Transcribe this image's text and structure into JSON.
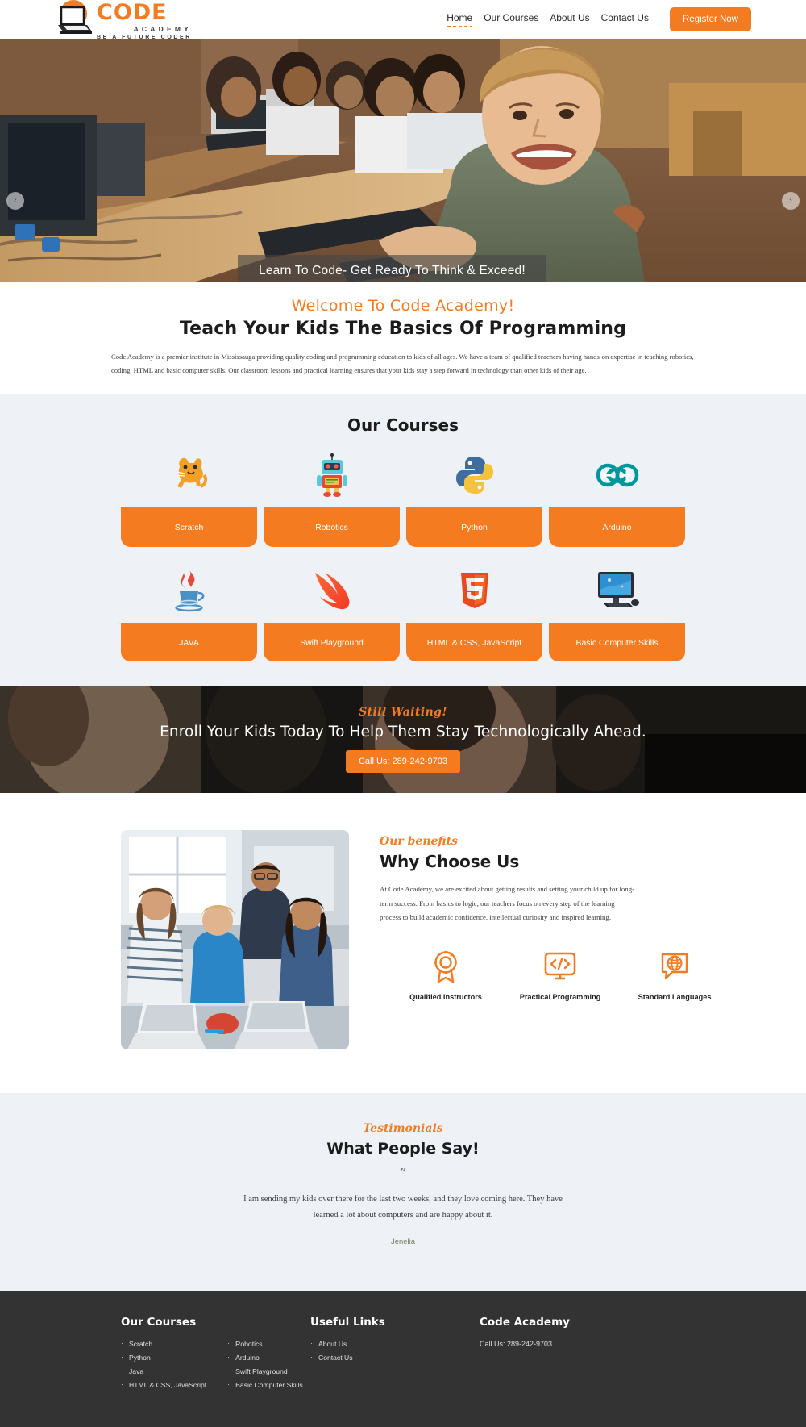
{
  "header": {
    "logo": {
      "code": "CODE",
      "academy": "ACADEMY",
      "tagline": "BE A FUTURE CODER"
    },
    "nav": [
      {
        "label": "Home",
        "active": true
      },
      {
        "label": "Our Courses",
        "active": false
      },
      {
        "label": "About Us",
        "active": false
      },
      {
        "label": "Contact Us",
        "active": false
      }
    ],
    "register_label": "Register Now"
  },
  "hero": {
    "caption": "Learn To Code- Get Ready To Think & Exceed!",
    "prev_icon": "chevron-left-icon",
    "next_icon": "chevron-right-icon"
  },
  "welcome": {
    "kicker": "Welcome To Code Academy!",
    "title": "Teach Your Kids The Basics Of Programming",
    "body": "Code Academy is a premier institute in Mississauga providing quality coding and programming education to kids of all ages. We have a team of qualified teachers having hands-on expertise in teaching robotics, coding, HTML and basic computer skills. Our classroom lessons and practical learning ensures that your kids stay a step forward in technology than other kids of their age."
  },
  "courses": {
    "title": "Our Courses",
    "row1": [
      {
        "label": "Scratch",
        "icon": "scratch-cat-icon"
      },
      {
        "label": "Robotics",
        "icon": "robot-icon"
      },
      {
        "label": "Python",
        "icon": "python-logo-icon"
      },
      {
        "label": "Arduino",
        "icon": "arduino-infinity-icon"
      }
    ],
    "row2": [
      {
        "label": "JAVA",
        "icon": "java-coffee-cup-icon"
      },
      {
        "label": "Swift Playground",
        "icon": "swift-bird-icon"
      },
      {
        "label": "HTML & CSS, JavaScript",
        "icon": "html5-shield-icon"
      },
      {
        "label": "Basic Computer Skills",
        "icon": "desktop-computer-icon"
      }
    ]
  },
  "cta": {
    "kicker": "Still Waiting!",
    "headline": "Enroll Your Kids Today To Help Them Stay Technologically Ahead.",
    "button": "Call Us: 289-242-9703"
  },
  "why": {
    "kicker": "Our benefits",
    "title": "Why Choose Us",
    "body": "At Code Academy, we are excited about getting results and setting your child up for long-term success. From basics to logic, our teachers focus on every step of the learning process to build academic confidence, intellectual curiosity and inspired learning.",
    "benefits": [
      {
        "label": "Qualified Instructors",
        "icon": "award-badge-icon"
      },
      {
        "label": "Practical Programming",
        "icon": "code-monitor-icon"
      },
      {
        "label": "Standard Languages",
        "icon": "globe-speech-icon"
      }
    ]
  },
  "testimonials": {
    "kicker": "Testimonials",
    "title": "What People Say!",
    "quote_mark": "”",
    "text": "I am sending my kids over there for the last two weeks, and they love coming here. They have learned a lot about computers and are happy about it.",
    "author": "Jenelia"
  },
  "footer": {
    "courses_heading": "Our Courses",
    "courses_col1": [
      "Scratch",
      "Python",
      "Java",
      "HTML & CSS, JavaScript"
    ],
    "courses_col2": [
      "Robotics",
      "Arduino",
      "Swift Playground",
      "Basic Computer Skills"
    ],
    "links_heading": "Useful Links",
    "links": [
      "About Us",
      "Contact Us"
    ],
    "about_heading": "Code Academy",
    "about_contact": "Call Us: 289-242-9703"
  },
  "colors": {
    "accent": "#F47B20",
    "dark": "#333333",
    "light_bg": "#eef2f7"
  }
}
